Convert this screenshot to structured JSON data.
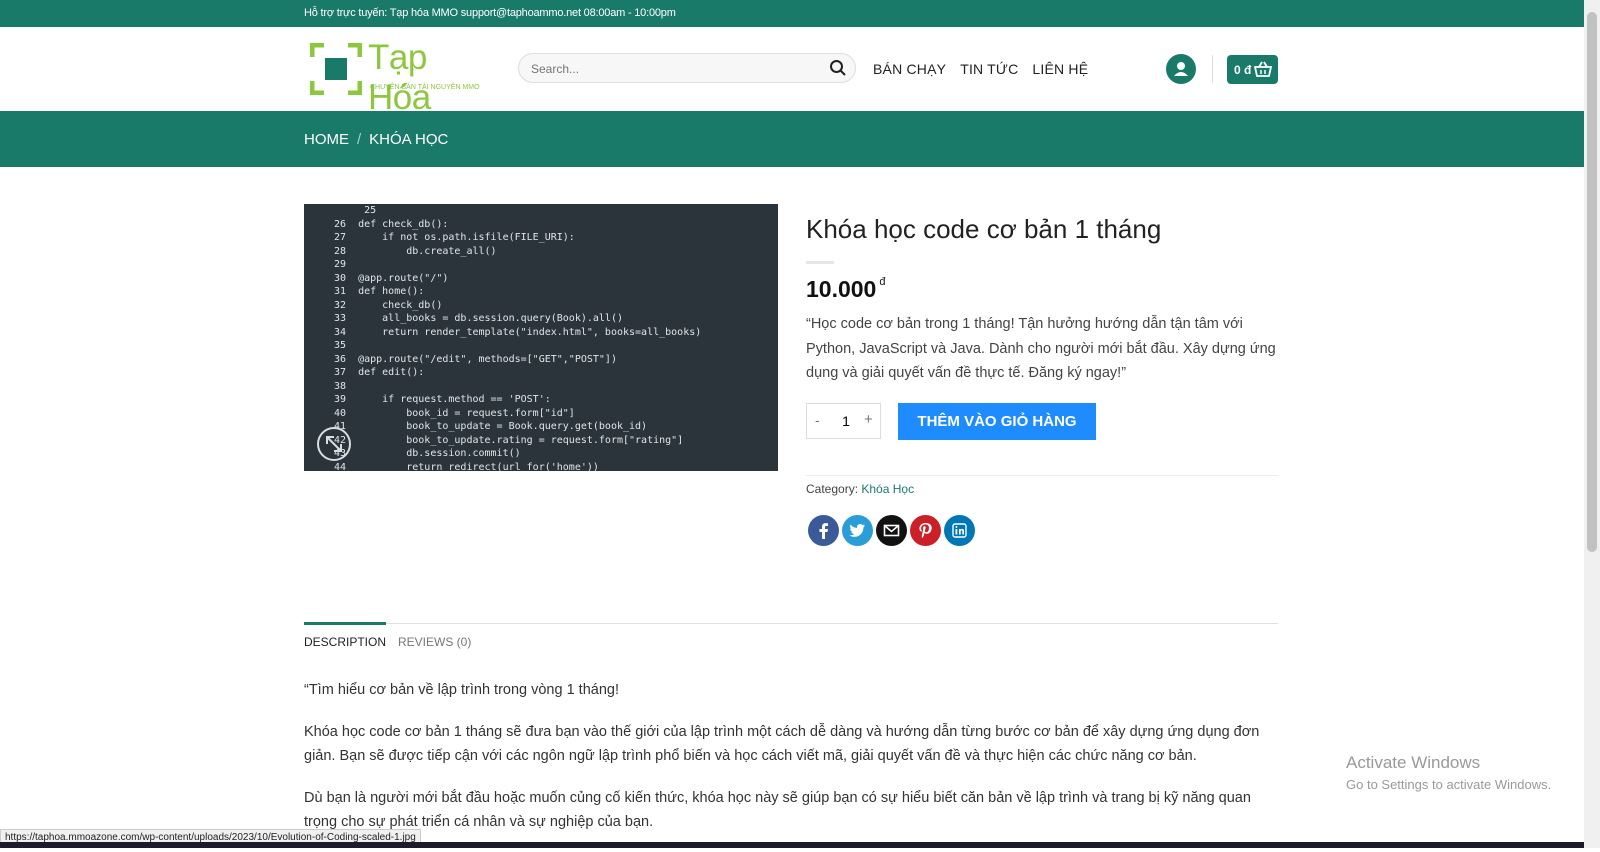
{
  "topbar": {
    "text": "Hỗ trợ trực tuyến: Tạp hóa MMO support@taphoammo.net 08:00am - 10:00pm"
  },
  "logo": {
    "title": "Tạp Hóa",
    "subtitle": "CHUYÊN BÁN TÀI NGUYÊN MMO"
  },
  "search": {
    "placeholder": "Search..."
  },
  "nav": {
    "items": [
      "BÁN CHẠY",
      "TIN TỨC",
      "LIÊN HỆ"
    ]
  },
  "cart": {
    "total": "0 đ"
  },
  "breadcrumb": {
    "home": "HOME",
    "separator": "/",
    "current": "KHÓA HỌC"
  },
  "product": {
    "title": "Khóa học code cơ bản 1 tháng",
    "price": "10.000",
    "currency": "đ",
    "short_description": "“Học code cơ bản trong 1 tháng! Tận hưởng hướng dẫn tận tâm với Python, JavaScript và Java. Dành cho người mới bắt đầu. Xây dựng ứng dụng và giải quyết vấn đề thực tế. Đăng ký ngay!”",
    "quantity": "1",
    "minus_label": "-",
    "plus_label": "+",
    "add_to_cart": "THÊM VÀO GIỎ HÀNG",
    "category_label": "Category:",
    "category_value": "Khóa Học"
  },
  "share": [
    "facebook-icon",
    "twitter-icon",
    "email-icon",
    "pinterest-icon",
    "linkedin-icon"
  ],
  "tabs": {
    "description": "DESCRIPTION",
    "reviews": "REVIEWS (0)"
  },
  "description": {
    "p1": "“Tìm hiểu cơ bản về lập trình trong vòng 1 tháng!",
    "p2": "Khóa học code cơ bản 1 tháng sẽ đưa bạn vào thế giới của lập trình một cách dễ dàng và hướng dẫn từng bước cơ bản để xây dựng ứng dụng đơn giản. Bạn sẽ được tiếp cận với các ngôn ngữ lập trình phổ biến và học cách viết mã, giải quyết vấn đề và thực hiện các chức năng cơ bản.",
    "p3": "Dù bạn là người mới bắt đầu hoặc muốn củng cố kiến thức, khóa học này sẽ giúp bạn có sự hiểu biết căn bản về lập trình và trang bị kỹ năng quan trọng cho sự phát triển cá nhân và sự nghiệp của bạn."
  },
  "status_url": "https://taphoa.mmoazone.com/wp-content/uploads/2023/10/Evolution-of-Coding-scaled-1.jpg",
  "activate": {
    "line1": "Activate Windows",
    "line2": "Go to Settings to activate Windows."
  },
  "code_image": {
    "code": "     25\n26  def check_db():\n27      if not os.path.isfile(FILE_URI):\n28          db.create_all()\n29\n30  @app.route(\"/\")\n31  def home():\n32      check_db()\n33      all_books = db.session.query(Book).all()\n34      return render_template(\"index.html\", books=all_books)\n35\n36  @app.route(\"/edit\", methods=[\"GET\",\"POST\"])\n37  def edit():\n38\n39      if request.method == 'POST':\n40          book_id = request.form[\"id\"]\n41          book_to_update = Book.query.get(book_id)\n42          book_to_update.rating = request.form[\"rating\"]\n43          db.session.commit()\n44          return redirect(url_for('home'))"
  }
}
